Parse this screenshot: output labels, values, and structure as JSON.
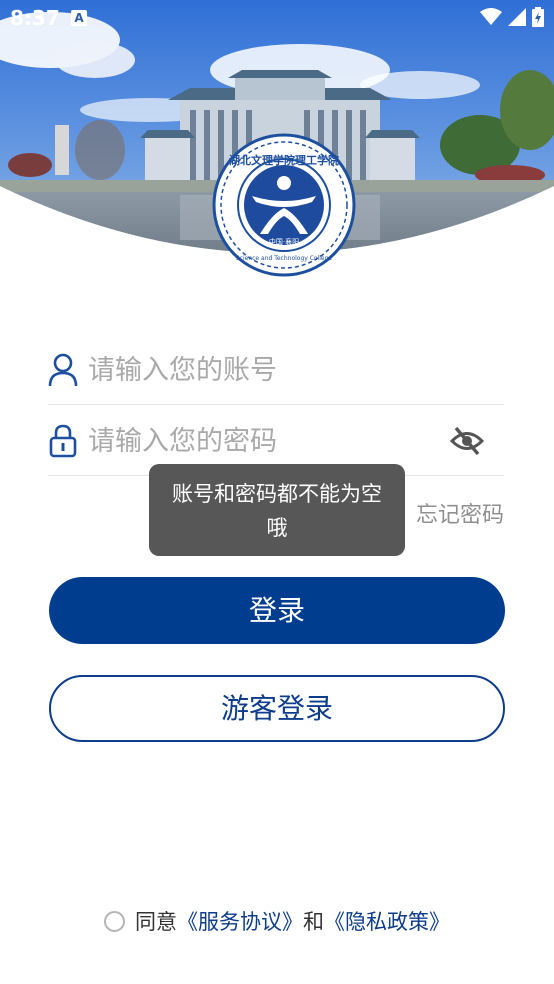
{
  "status_bar": {
    "time": "8:37",
    "notification_badge": "A"
  },
  "login": {
    "account_placeholder": "请输入您的账号",
    "password_placeholder": "请输入您的密码",
    "forgot_password": "忘记密码",
    "toast": "账号和密码都不能为空哦",
    "login_button": "登录",
    "guest_button": "游客登录"
  },
  "agreement": {
    "prefix": "同意",
    "service_link": "《服务协议》",
    "and": "和",
    "privacy_link": "《隐私政策》"
  },
  "emblem": {
    "name": "湖北文理学院理工学院",
    "english": "Science and Technology College of Hubei University of Arts and Science",
    "place": "中国·襄阳"
  },
  "colors": {
    "primary": "#003d8f",
    "toast_bg": "#575757",
    "placeholder": "#a9a9a9"
  },
  "icons": [
    "user-icon",
    "lock-icon",
    "eye-off-icon",
    "wifi-icon",
    "signal-icon",
    "battery-icon"
  ]
}
